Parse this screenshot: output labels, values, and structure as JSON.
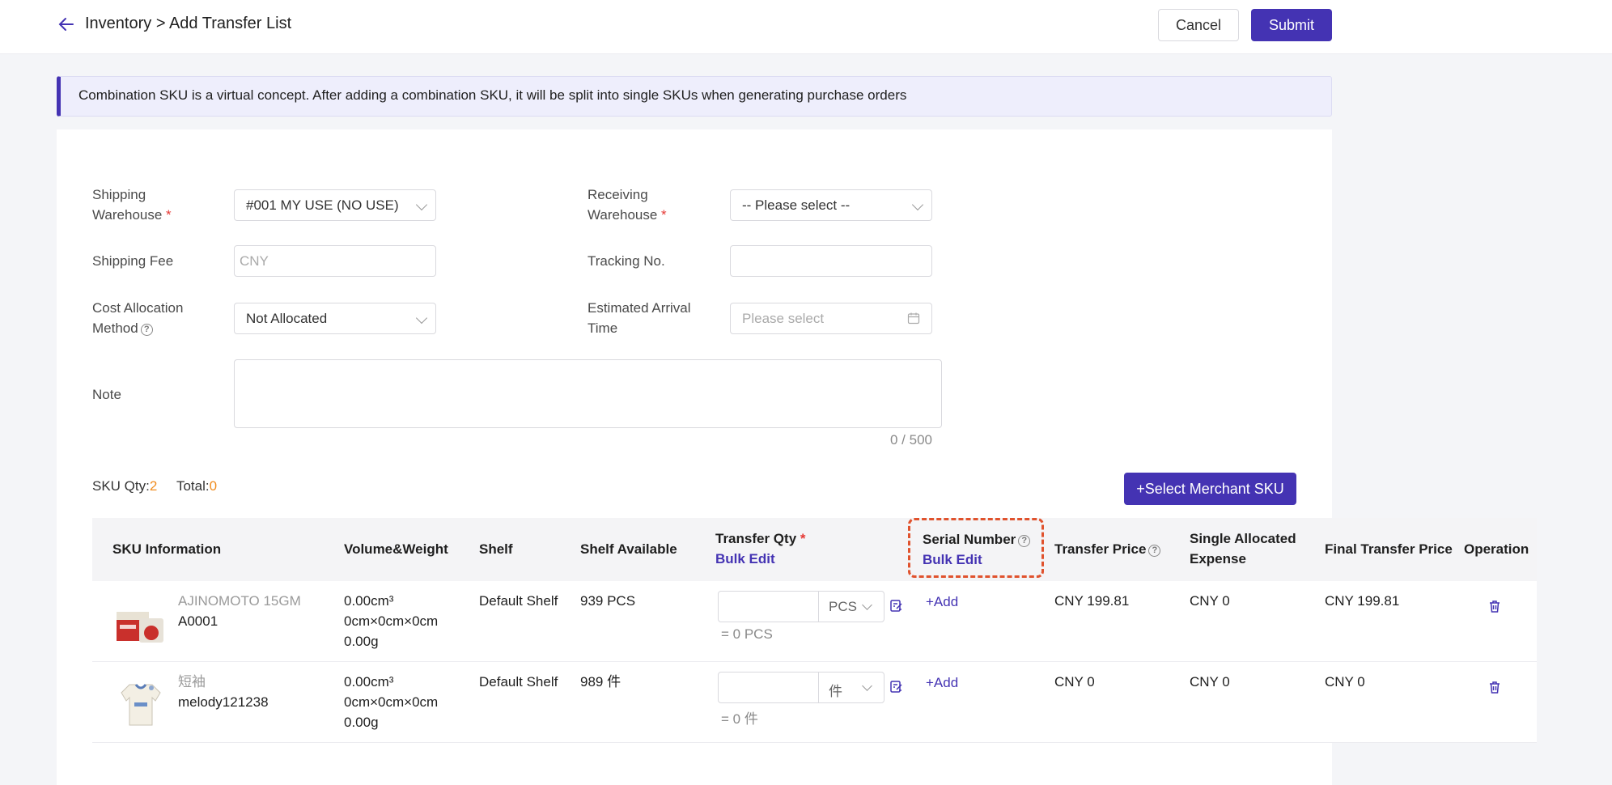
{
  "header": {
    "breadcrumb": "Inventory > Add Transfer List",
    "cancel_label": "Cancel",
    "submit_label": "Submit"
  },
  "notice": "Combination SKU is a virtual concept. After adding a combination SKU, it will be split into single SKUs when generating purchase orders",
  "form": {
    "shipping_warehouse_label_1": "Shipping",
    "shipping_warehouse_label_2": "Warehouse",
    "shipping_warehouse_value": "#001 MY USE (NO USE)",
    "receiving_warehouse_label_1": "Receiving",
    "receiving_warehouse_label_2": "Warehouse",
    "receiving_warehouse_placeholder": "-- Please select --",
    "shipping_fee_label": "Shipping Fee",
    "shipping_fee_placeholder": "CNY",
    "tracking_label": "Tracking No.",
    "cost_method_label_1": "Cost Allocation",
    "cost_method_label_2": "Method",
    "cost_method_value": "Not Allocated",
    "eta_label_1": "Estimated Arrival",
    "eta_label_2": "Time",
    "eta_placeholder": "Please select",
    "note_label": "Note",
    "note_counter": "0 / 500",
    "required_mark": "*"
  },
  "summary": {
    "sku_qty_label": "SKU Qty:",
    "sku_qty": "2",
    "total_label": "Total:",
    "total": "0",
    "select_button": "+Select Merchant SKU"
  },
  "table": {
    "headers": {
      "sku_info": "SKU Information",
      "volume": "Volume&Weight",
      "shelf": "Shelf",
      "shelf_available": "Shelf Available",
      "transfer_qty": "Transfer Qty",
      "bulk_edit": "Bulk Edit",
      "serial_number": "Serial Number",
      "transfer_price": "Transfer Price",
      "single_alloc_1": "Single Allocated",
      "single_alloc_2": "Expense",
      "final_price": "Final Transfer Price",
      "operation": "Operation"
    },
    "rows": [
      {
        "name": "AJINOMOTO 15GM",
        "sku": "A0001",
        "volume": "0.00cm³",
        "dims": "0cm×0cm×0cm",
        "weight": "0.00g",
        "shelf": "Default Shelf",
        "available": "939 PCS",
        "unit": "PCS",
        "qty_eq": "= 0 PCS",
        "add": "+Add",
        "transfer_price": "CNY 199.81",
        "alloc": "CNY 0",
        "final_price": "CNY 199.81"
      },
      {
        "name": "短袖",
        "sku": "melody121238",
        "volume": "0.00cm³",
        "dims": "0cm×0cm×0cm",
        "weight": "0.00g",
        "shelf": "Default Shelf",
        "available": "989 件",
        "unit": "件",
        "qty_eq": "= 0 件",
        "add": "+Add",
        "transfer_price": "CNY 0",
        "alloc": "CNY 0",
        "final_price": "CNY 0"
      }
    ]
  },
  "colors": {
    "primary": "#4433b3",
    "required": "#e53935",
    "count": "#f08c1e",
    "highlight": "#e0522d"
  }
}
